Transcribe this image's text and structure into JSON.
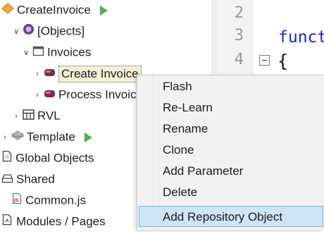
{
  "tree": {
    "items": [
      {
        "label": "CreateInvoice",
        "icon": "diamond-icon"
      },
      {
        "label": "[Objects]",
        "icon": "objects-icon"
      },
      {
        "label": "Invoices",
        "icon": "folder-window-icon"
      },
      {
        "label": "Create Invoice",
        "icon": "repository-object-icon"
      },
      {
        "label": "Process Invoic",
        "icon": "repository-object-icon"
      },
      {
        "label": "RVL",
        "icon": "table-icon"
      },
      {
        "label": "Template",
        "icon": "template-icon"
      },
      {
        "label": "Global Objects",
        "icon": "document-icon"
      },
      {
        "label": "Shared",
        "icon": "shared-icon"
      },
      {
        "label": "Common.js",
        "icon": "js-file-icon"
      },
      {
        "label": "Modules / Pages",
        "icon": "modules-icon"
      }
    ]
  },
  "editor": {
    "line_numbers": [
      "2",
      "3",
      "4"
    ],
    "keyword": "funct",
    "brace": "{"
  },
  "context_menu": {
    "items": [
      "Flash",
      "Re-Learn",
      "Rename",
      "Clone",
      "Add Parameter",
      "Delete",
      "Add Repository Object"
    ],
    "highlighted": "Add Repository Object"
  },
  "colors": {
    "play": "#4caf50",
    "keyword": "#1a28c8",
    "menu_highlight": "#cde5f7"
  }
}
